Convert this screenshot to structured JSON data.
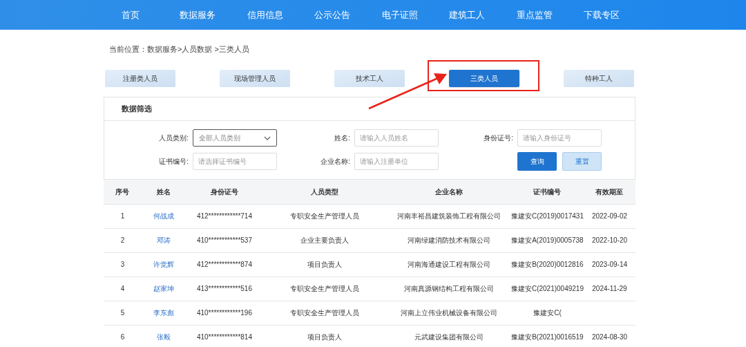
{
  "nav": [
    {
      "label": "首页"
    },
    {
      "label": "数据服务"
    },
    {
      "label": "信用信息"
    },
    {
      "label": "公示公告"
    },
    {
      "label": "电子证照"
    },
    {
      "label": "建筑工人"
    },
    {
      "label": "重点监管"
    },
    {
      "label": "下载专区"
    }
  ],
  "breadcrumb": "当前位置：数据服务>人员数据 >三类人员",
  "tabs": [
    {
      "label": "注册类人员",
      "selected": false
    },
    {
      "label": "现场管理人员",
      "selected": false
    },
    {
      "label": "技术工人",
      "selected": false
    },
    {
      "label": "三类人员",
      "selected": true
    },
    {
      "label": "特种工人",
      "selected": false
    }
  ],
  "filter": {
    "title": "数据筛选",
    "fields": [
      {
        "label": "人员类别:",
        "kind": "select",
        "value": "全部人员类别"
      },
      {
        "label": "姓名:",
        "kind": "input",
        "placeholder": "请输入人员姓名"
      },
      {
        "label": "身份证号:",
        "kind": "input",
        "placeholder": "请输入身份证号"
      },
      {
        "label": "证书编号:",
        "kind": "input",
        "placeholder": "请选择证书编号"
      },
      {
        "label": "企业名称:",
        "kind": "input",
        "placeholder": "请输入注册单位"
      }
    ],
    "buttons": [
      {
        "label": "查询",
        "kind": "primary"
      },
      {
        "label": "重置",
        "kind": "secondary"
      }
    ]
  },
  "table": {
    "columns": [
      "序号",
      "姓名",
      "身份证号",
      "人员类型",
      "企业名称",
      "证书编号",
      "有效期至"
    ],
    "rows": [
      [
        "1",
        "何战成",
        "412************714",
        "专职安全生产管理人员",
        "河南丰裕昌建筑装饰工程有限公司",
        "豫建安C(2019)0017431",
        "2022-09-02"
      ],
      [
        "2",
        "邓涛",
        "410************537",
        "企业主要负责人",
        "河南绿建消防技术有限公司",
        "豫建安A(2019)0005738",
        "2022-10-20"
      ],
      [
        "3",
        "许觉辉",
        "412************874",
        "项目负责人",
        "河南海通建设工程有限公司",
        "豫建安B(2020)0012816",
        "2023-09-14"
      ],
      [
        "4",
        "赵家坤",
        "413************516",
        "专职安全生产管理人员",
        "河南真源钢结构工程有限公司",
        "豫建安C(2021)0049219",
        "2024-11-29"
      ],
      [
        "5",
        "李东彪",
        "410************196",
        "专职安全生产管理人员",
        "河南上立伟业机械设备有限公司",
        "豫建安C(",
        ""
      ],
      [
        "6",
        "张毅",
        "410************814",
        "项目负责人",
        "元武建设集团有限公司",
        "豫建安B(2021)0016519",
        "2024-08-30"
      ]
    ]
  }
}
